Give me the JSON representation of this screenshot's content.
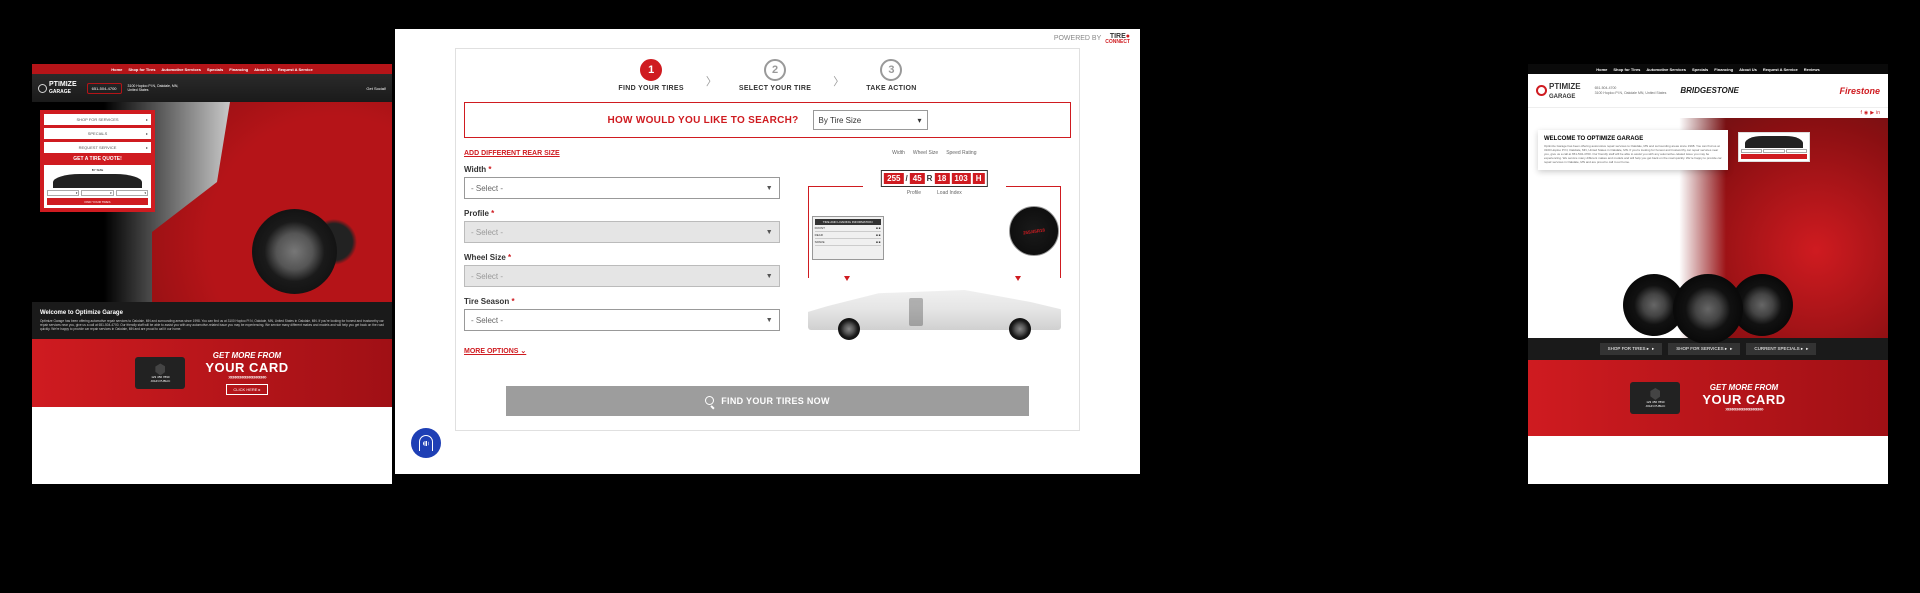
{
  "left": {
    "nav": [
      "Home",
      "Shop for Tires",
      "Automotive Services",
      "Specials",
      "Financing",
      "About Us",
      "Request A Service"
    ],
    "logo_top": "PTIMIZE",
    "logo_bot": "GARAGE",
    "phone": "651-504-4700",
    "address": "3100 Hoploo Pl N, Oakdale, MN, United States",
    "social_label": "Get Social!",
    "sidebar_btns": [
      "SHOP FOR SERVICES",
      "SPECIALS",
      "REQUEST SERVICE"
    ],
    "quote_title": "GET A TIRE QUOTE!",
    "quote_tab": "BY SIZE",
    "quote_find": "FIND YOUR TIRES",
    "welcome_title": "Welcome to Optimize Garage",
    "welcome_body": "Optimize Garage has been offering automotive repair services to Oakdale, MN and surrounding areas since 1998. You can find us at 3100 Hoploo Pl N, Oakdale, MN, United States in Oakdale, MN. If you're looking for honest and trustworthy car repair services near you, give us a call at 651-504-4700. Our friendly staff will be able to assist you with any automotive-related issue you may be experiencing. We service many different makes and models and will help you get back on the road quickly. We're happy to provide car repair services in Oakdale, MN and are proud to call it our home.",
    "promo_l1a": "GET ",
    "promo_l1b": "MORE",
    "promo_l1c": " FROM",
    "promo_l2": "YOUR CARD",
    "promo_btn": "CLICK HERE  ▸",
    "card_num": "123 456 7890",
    "card_name": "JOHN PUBLIC"
  },
  "center": {
    "powered": "POWERED BY",
    "tc1": "TIRE",
    "tc2": "CONNECT",
    "steps": [
      {
        "num": "1",
        "label": "FIND YOUR TIRES"
      },
      {
        "num": "2",
        "label": "SELECT YOUR TIRE"
      },
      {
        "num": "3",
        "label": "TAKE ACTION"
      }
    ],
    "search_label": "HOW WOULD YOU LIKE TO SEARCH?",
    "search_value": "By Tire Size",
    "rear_link": "ADD DIFFERENT REAR SIZE",
    "fields": {
      "width": {
        "label": "Width",
        "placeholder": "- Select -",
        "required": true,
        "disabled": false
      },
      "profile": {
        "label": "Profile",
        "placeholder": "- Select -",
        "required": true,
        "disabled": true
      },
      "wheel": {
        "label": "Wheel Size",
        "placeholder": "- Select -",
        "required": true,
        "disabled": true
      },
      "season": {
        "label": "Tire Season",
        "placeholder": "- Select -",
        "required": true,
        "disabled": false
      }
    },
    "more_link": "MORE OPTIONS  ⌄",
    "diagram": {
      "top_labels": [
        "Width",
        "Wheel Size",
        "Speed Rating"
      ],
      "code": [
        "255",
        "/",
        "45",
        "R",
        "18",
        "103",
        "H"
      ],
      "sub_labels": [
        "Profile",
        "Load Index"
      ],
      "placard_title": "TIRE AND LOADING INFORMATION",
      "sidewall": "255/45R18"
    },
    "submit": "FIND YOUR TIRES NOW"
  },
  "right": {
    "nav": [
      "Home",
      "Shop for Tires",
      "Automotive Services",
      "Specials",
      "Financing",
      "About Us",
      "Request A Service",
      "Reviews"
    ],
    "logo_top": "PTIMIZE",
    "logo_bot": "GARAGE",
    "phone": "651-504-4700",
    "address": "3100 Hoploo Pl N, Oakdale MN, United States",
    "brand1": "BRIDGESTONE",
    "brand2": "Firestone",
    "welcome_title": "WELCOME TO OPTIMIZE GARAGE",
    "welcome_body": "Optimize Garage has been offering automotive repair services to Oakdale, MN and surrounding areas since 1998. You can find us at 3100 Hoploo Pl N, Oakdale, MN, United States in Oakdale, MN. If you're looking for honest and trustworthy car repair services near you, give us a call at 651-504-4700. Our friendly staff will be able to assist you with any automotive-related issue you may be experiencing. We service many different makes and models and will help you get back on the road quickly. We're happy to provide car repair services in Oakdale, MN and are proud to call it our home.",
    "quote_find": "FIND YOUR TIRES",
    "cta": [
      "SHOP FOR TIRES ▸",
      "SHOP FOR SERVICES ▸",
      "CURRENT SPECIALS ▸"
    ],
    "promo_l1a": "GET ",
    "promo_l1b": "MORE",
    "promo_l1c": " FROM",
    "promo_l2": "YOUR CARD",
    "card_num": "123 456 7890",
    "card_name": "JOHN PUBLIC"
  }
}
